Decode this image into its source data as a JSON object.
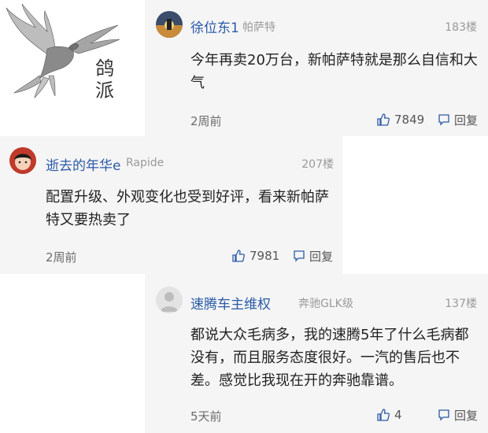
{
  "logo": {
    "line1": "鸽",
    "line2": "派"
  },
  "comments": [
    {
      "username": "徐位东1",
      "car_tag": "帕萨特",
      "floor": "183楼",
      "content": "今年再卖20万台，新帕萨特就是那么自信和大气",
      "time": "2周前",
      "likes": "7849",
      "reply_label": "回复",
      "avatar_icon": "sunset-avatar"
    },
    {
      "username": "逝去的年华e",
      "car_tag": "Rapide",
      "floor": "207楼",
      "content": "配置升级、外观变化也受到好评，看来新帕萨特又要热卖了",
      "time": "2周前",
      "likes": "7981",
      "reply_label": "回复",
      "avatar_icon": "child-avatar"
    },
    {
      "username": "速腾车主维权",
      "car_tag": "奔驰GLK级",
      "floor": "137楼",
      "content": "都说大众毛病多，我的速腾5年了什么毛病都没有，而且服务态度很好。一汽的售后也不差。感觉比我现在开的奔驰靠谱。",
      "time": "5天前",
      "likes": "4",
      "reply_label": "回复",
      "avatar_icon": "default-user-avatar"
    }
  ],
  "colors": {
    "username": "#2a5aa8",
    "card_bg": "#f5f5f5",
    "meta_gray": "#9a9a9a"
  }
}
